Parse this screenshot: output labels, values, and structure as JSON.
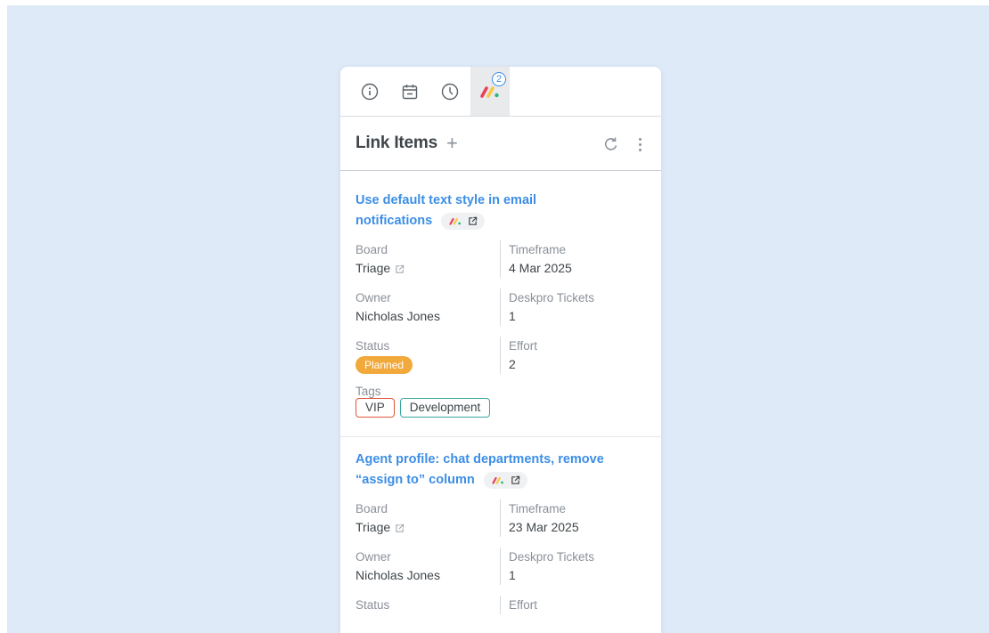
{
  "tabs": [
    {
      "icon": "info-icon"
    },
    {
      "icon": "calendar-icon"
    },
    {
      "icon": "clock-icon"
    },
    {
      "icon": "monday-logo-icon",
      "badge": "2",
      "active": true
    }
  ],
  "header": {
    "title": "Link Items",
    "add_icon": "plus-icon",
    "refresh_icon": "refresh-icon",
    "menu_icon": "kebab-menu-icon"
  },
  "labels": {
    "board": "Board",
    "timeframe": "Timeframe",
    "owner": "Owner",
    "tickets": "Deskpro Tickets",
    "status": "Status",
    "effort": "Effort",
    "tags": "Tags"
  },
  "items": [
    {
      "title_line1": "Use default text style in email",
      "title_line2": "notifications",
      "board": "Triage",
      "timeframe": "4 Mar 2025",
      "owner": "Nicholas Jones",
      "tickets": "1",
      "status": "Planned",
      "effort": "2",
      "tags": [
        "VIP",
        "Development"
      ]
    },
    {
      "title_line1": "Agent profile: chat departments, remove",
      "title_line2": "“assign to” column",
      "board": "Triage",
      "timeframe": "23 Mar 2025",
      "owner": "Nicholas Jones",
      "tickets": "1",
      "status": "",
      "effort": ""
    }
  ],
  "colors": {
    "accent": "#3c8ee5",
    "planned": "#f2a93b",
    "vip": "#e0533c",
    "development": "#3aa6a0",
    "backdrop": "#dfeaf8"
  }
}
